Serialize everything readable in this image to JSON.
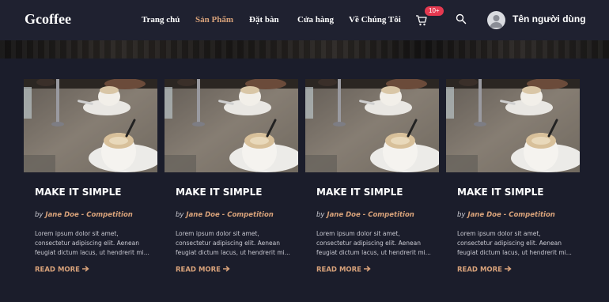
{
  "header": {
    "brand": "Gcoffee",
    "nav": [
      {
        "label": "Trang chủ",
        "active": false
      },
      {
        "label": "Sản Phẩm",
        "active": true
      },
      {
        "label": "Đặt bàn",
        "active": false
      },
      {
        "label": "Cửa hàng",
        "active": false
      },
      {
        "label": "Về Chúng Tôi",
        "active": false
      }
    ],
    "cart_badge": "10+",
    "username": "Tên người dùng"
  },
  "colors": {
    "accent": "#d8a27a",
    "badge": "#e53950",
    "background": "#1b1d2b"
  },
  "cards": [
    {
      "title": "MAKE IT SIMPLE",
      "by": "by",
      "author": "Jane Doe",
      "sep": "-",
      "category": "Competition",
      "excerpt": "Lorem ipsum dolor sit amet, consectetur adipiscing elit. Aenean feugiat dictum lacus, ut hendrerit mi...",
      "more": "READ MORE"
    },
    {
      "title": "MAKE IT SIMPLE",
      "by": "by",
      "author": "Jane Doe",
      "sep": "-",
      "category": "Competition",
      "excerpt": "Lorem ipsum dolor sit amet, consectetur adipiscing elit. Aenean feugiat dictum lacus, ut hendrerit mi...",
      "more": "READ MORE"
    },
    {
      "title": "MAKE IT SIMPLE",
      "by": "by",
      "author": "Jane Doe",
      "sep": "-",
      "category": "Competition",
      "excerpt": "Lorem ipsum dolor sit amet, consectetur adipiscing elit. Aenean feugiat dictum lacus, ut hendrerit mi...",
      "more": "READ MORE"
    },
    {
      "title": "MAKE IT SIMPLE",
      "by": "by",
      "author": "Jane Doe",
      "sep": "-",
      "category": "Competition",
      "excerpt": "Lorem ipsum dolor sit amet, consectetur adipiscing elit. Aenean feugiat dictum lacus, ut hendrerit mi...",
      "more": "READ MORE"
    }
  ]
}
